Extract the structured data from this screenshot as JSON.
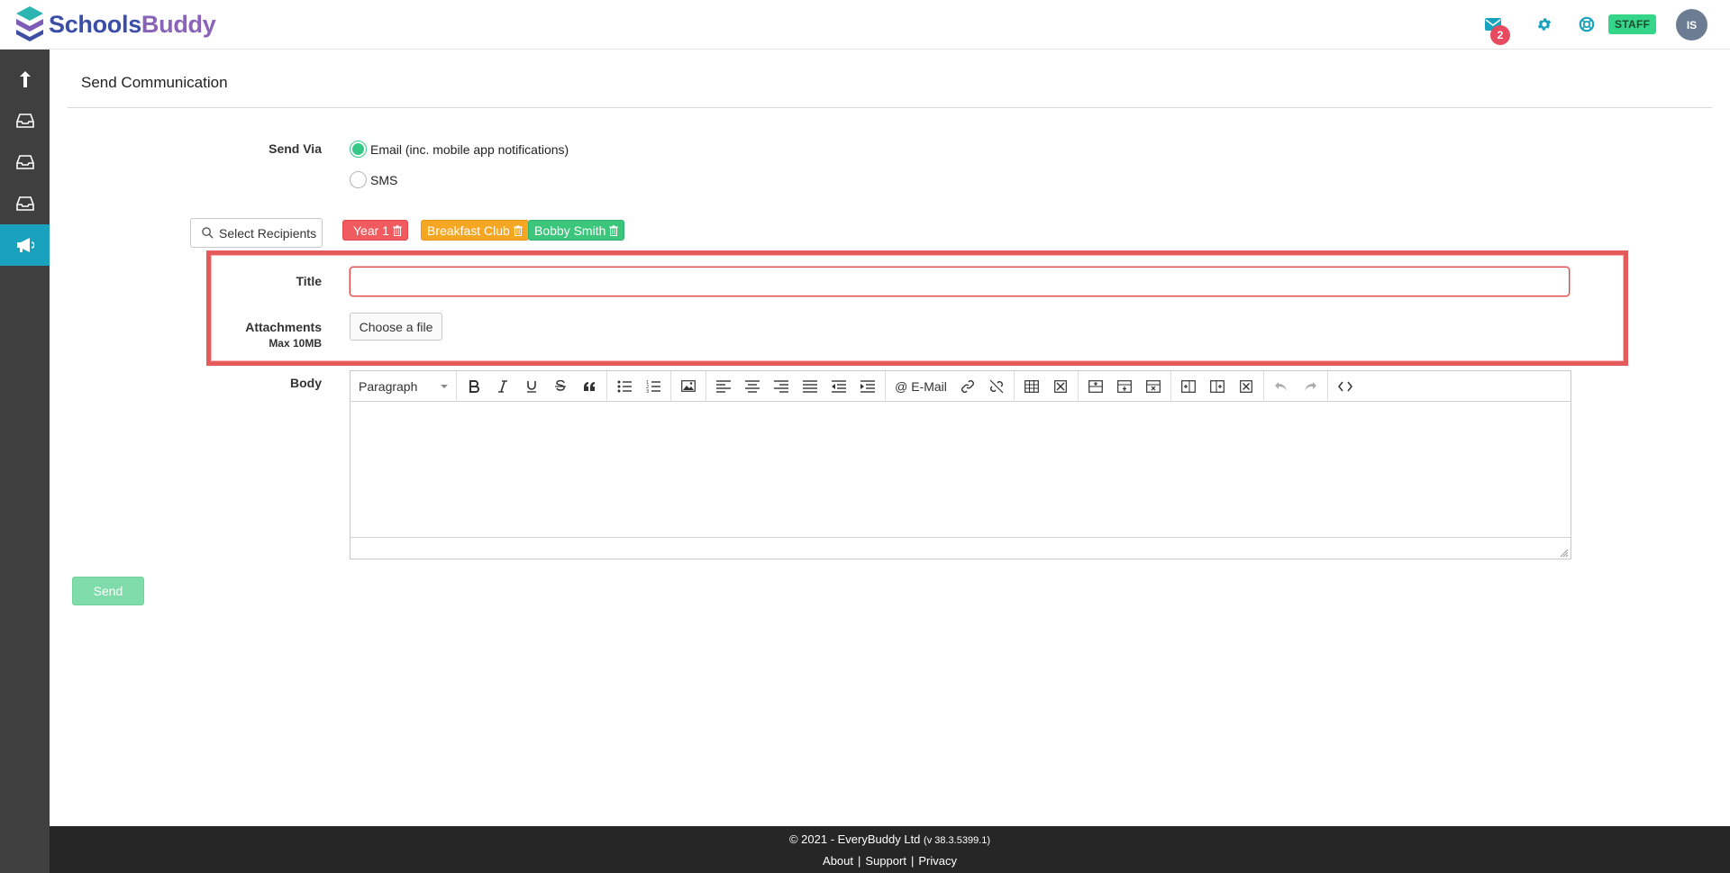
{
  "brand": {
    "name_part1": "Schools",
    "name_part2": "Buddy"
  },
  "header": {
    "notification_count": "2",
    "role_badge": "STAFF",
    "avatar_initials": "IS"
  },
  "colors": {
    "accent": "#18a2bd",
    "tag_year1": "#ef5b5f",
    "tag_breakfast": "#f5a623",
    "tag_bobby": "#3bc67c",
    "send_button": "#7fdcaa"
  },
  "sidebar": {
    "items": [
      {
        "icon": "upload-arrow-icon"
      },
      {
        "icon": "inbox-icon"
      },
      {
        "icon": "inbox-icon"
      },
      {
        "icon": "inbox-icon"
      },
      {
        "icon": "megaphone-icon",
        "active": true
      }
    ]
  },
  "page": {
    "title": "Send Communication"
  },
  "form": {
    "send_via_label": "Send Via",
    "options": {
      "email": "Email (inc. mobile app notifications)",
      "sms": "SMS"
    },
    "select_recipients": "Select Recipients",
    "recipients": [
      "Year 1",
      "Breakfast Club",
      "Bobby Smith"
    ],
    "title_label": "Title",
    "title_value": "",
    "attachments_label": "Attachments",
    "attachments_hint": "Max 10MB",
    "choose_file": "Choose a file",
    "body_label": "Body",
    "send": "Send"
  },
  "editor": {
    "format_select": "Paragraph",
    "email_button": "@ E-Mail"
  },
  "footer": {
    "copyright": "© 2021 - EveryBuddy Ltd",
    "version": "(v 38.3.5399.1)",
    "links": [
      "About",
      "Support",
      "Privacy"
    ]
  }
}
